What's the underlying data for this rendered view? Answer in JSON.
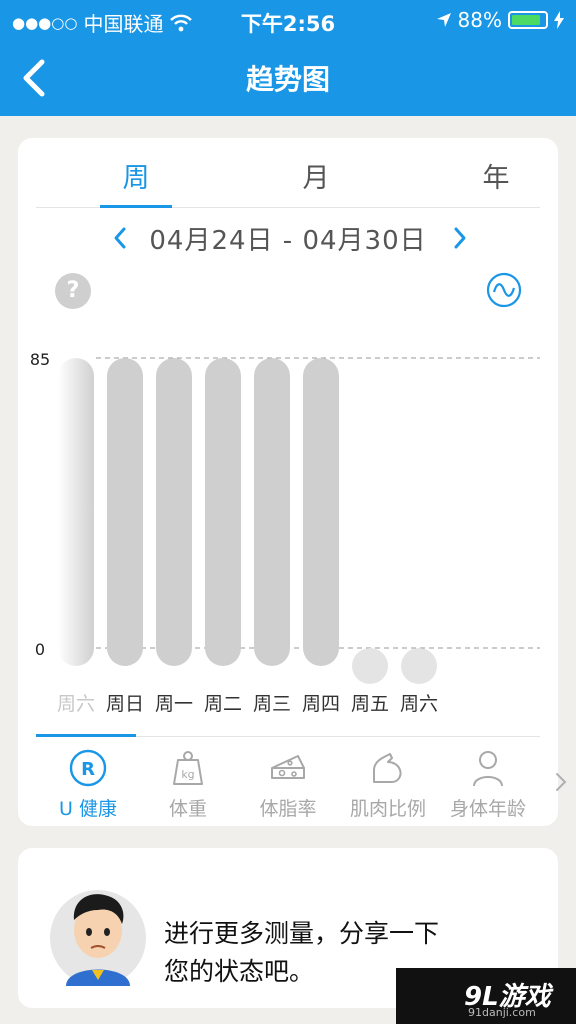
{
  "status_bar": {
    "carrier": "中国联通",
    "time": "下午2:56",
    "battery_percent": "88%",
    "battery_level": 0.88
  },
  "nav": {
    "title": "趋势图"
  },
  "period_tabs": [
    {
      "label": "周",
      "active": true
    },
    {
      "label": "月",
      "active": false
    },
    {
      "label": "年",
      "active": false
    }
  ],
  "date_range": "04月24日 - 04月30日",
  "help_label": "?",
  "chart_data": {
    "type": "bar",
    "categories": [
      "周六",
      "周日",
      "周一",
      "周二",
      "周三",
      "周四",
      "周五",
      "周六"
    ],
    "values": [
      85,
      85,
      85,
      85,
      85,
      85,
      0,
      0
    ],
    "has_data": [
      true,
      true,
      true,
      true,
      true,
      true,
      false,
      false
    ],
    "first_bar_fading": true,
    "reference_lines": [
      85,
      0
    ],
    "ylim": [
      0,
      85
    ],
    "ytick_labels": [
      "85",
      "0"
    ],
    "bar_color": "#cfcfcf",
    "grid": "dashed reference lines",
    "title": "",
    "xlabel": "",
    "ylabel": ""
  },
  "metrics": [
    {
      "label": "U 健康",
      "icon": "u-health-icon",
      "active": true
    },
    {
      "label": "体重",
      "icon": "weight-scale-icon",
      "active": false
    },
    {
      "label": "体脂率",
      "icon": "cheese-icon",
      "active": false
    },
    {
      "label": "肌肉比例",
      "icon": "muscle-arm-icon",
      "active": false
    },
    {
      "label": "身体年龄",
      "icon": "person-icon",
      "active": false
    }
  ],
  "tip": {
    "line1": "进行更多测量，分享一下",
    "line2": "您的状态吧。"
  },
  "watermark": {
    "logo": "9L游戏",
    "site": "91danji.com"
  },
  "colors": {
    "accent": "#1a96e6",
    "background": "#f1efec",
    "bar": "#cfcfcf",
    "inactive": "#a8a8a8"
  }
}
